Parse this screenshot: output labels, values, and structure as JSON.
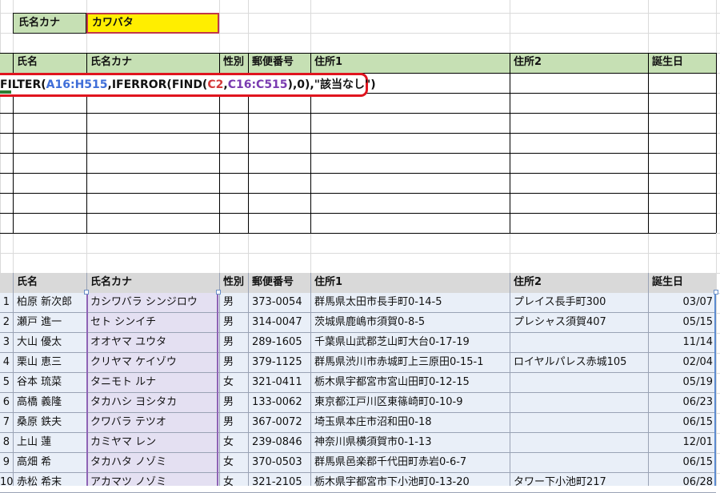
{
  "search": {
    "label": "氏名カナ",
    "value": "カワバタ"
  },
  "formula": {
    "parts": [
      {
        "text": "FILTER(",
        "color": "black"
      },
      {
        "text": "A16:H515",
        "color": "blue"
      },
      {
        "text": ",IFERROR(FIND(",
        "color": "black"
      },
      {
        "text": "C2",
        "color": "red"
      },
      {
        "text": ",",
        "color": "black"
      },
      {
        "text": "C16:C515",
        "color": "purple"
      },
      {
        "text": "),0),\"該当なし\")",
        "color": "black"
      }
    ]
  },
  "result_table": {
    "headers": [
      "氏名",
      "氏名カナ",
      "性別",
      "郵便番号",
      "住所1",
      "住所2",
      "誕生日"
    ]
  },
  "data_table": {
    "headers": [
      "氏名",
      "氏名カナ",
      "性別",
      "郵便番号",
      "住所1",
      "住所2",
      "誕生日"
    ],
    "rows": [
      {
        "no": "1",
        "name": "柏原 新次郎",
        "kana": "カシワバラ シンジロウ",
        "sex": "男",
        "zip": "373-0054",
        "addr1": "群馬県太田市長手町0-14-5",
        "addr2": "プレイス長手町300",
        "birthday": "03/07"
      },
      {
        "no": "2",
        "name": "瀬戸 進一",
        "kana": "セト シンイチ",
        "sex": "男",
        "zip": "314-0047",
        "addr1": "茨城県鹿嶋市須賀0-8-5",
        "addr2": "プレシャス須賀407",
        "birthday": "05/15"
      },
      {
        "no": "3",
        "name": "大山 優太",
        "kana": "オオヤマ ユウタ",
        "sex": "男",
        "zip": "289-1605",
        "addr1": "千葉県山武郡芝山町大台0-17-19",
        "addr2": "",
        "birthday": "11/14"
      },
      {
        "no": "4",
        "name": "栗山 恵三",
        "kana": "クリヤマ ケイゾウ",
        "sex": "男",
        "zip": "379-1125",
        "addr1": "群馬県渋川市赤城町上三原田0-15-1",
        "addr2": "ロイヤルパレス赤城105",
        "birthday": "02/04"
      },
      {
        "no": "5",
        "name": "谷本 琉菜",
        "kana": "タニモト ルナ",
        "sex": "女",
        "zip": "321-0411",
        "addr1": "栃木県宇都宮市宮山田町0-12-15",
        "addr2": "",
        "birthday": "05/19"
      },
      {
        "no": "6",
        "name": "高橋 義隆",
        "kana": "タカハシ ヨシタカ",
        "sex": "男",
        "zip": "133-0062",
        "addr1": "東京都江戸川区東篠崎町0-10-9",
        "addr2": "",
        "birthday": "06/23"
      },
      {
        "no": "7",
        "name": "桑原 鉄夫",
        "kana": "クワバラ テツオ",
        "sex": "男",
        "zip": "367-0072",
        "addr1": "埼玉県本庄市沼和田0-18",
        "addr2": "",
        "birthday": "06/15"
      },
      {
        "no": "8",
        "name": "上山 蓮",
        "kana": "カミヤマ レン",
        "sex": "女",
        "zip": "239-0846",
        "addr1": "神奈川県横須賀市0-1-13",
        "addr2": "",
        "birthday": "12/01"
      },
      {
        "no": "9",
        "name": "高畑 希",
        "kana": "タカハタ ノゾミ",
        "sex": "女",
        "zip": "370-0503",
        "addr1": "群馬県邑楽郡千代田町赤岩0-6-7",
        "addr2": "",
        "birthday": "06/15"
      },
      {
        "no": "10",
        "name": "赤松 希末",
        "kana": "アカマツ ノゾミ",
        "sex": "女",
        "zip": "321-2105",
        "addr1": "栃木県宇都宮市下小池町0-13-20",
        "addr2": "タワー下小池町217",
        "birthday": "06/28"
      }
    ]
  },
  "colors": {
    "header_green": "#c6e0b4",
    "header_gray": "#d9d9d9",
    "search_yellow": "#ffee00",
    "formula_border": "#e0141e",
    "kana_column": "#e4e0f2",
    "data_area": "#e9eff8"
  }
}
